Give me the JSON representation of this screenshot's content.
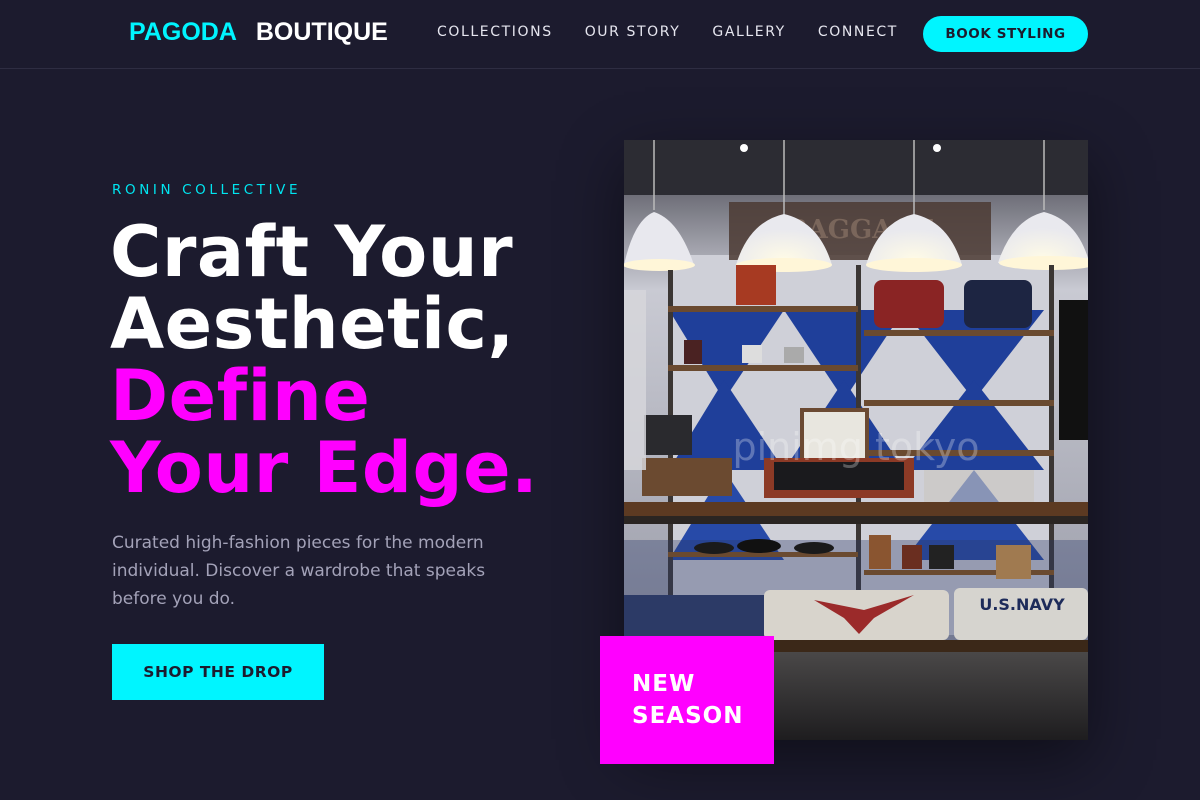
{
  "brand": {
    "part1": "PAGODA",
    "part2": "BOUTIQUE"
  },
  "nav": {
    "links": [
      "COLLECTIONS",
      "OUR STORY",
      "GALLERY",
      "CONNECT"
    ],
    "cta": "BOOK STYLING"
  },
  "hero": {
    "eyebrow": "RONIN COLLECTIVE",
    "headline": {
      "line1": "Craft Your",
      "line2": "Aesthetic,",
      "line3": "Define",
      "line4": "Your Edge."
    },
    "description": "Curated high-fashion pieces for the modern individual. Discover a wardrobe that speaks before you do.",
    "button": "SHOP THE DROP"
  },
  "image": {
    "store_sign": "BAGGAGE",
    "watermark": "pinimg tokyo",
    "shirt_text": "U.S.NAVY",
    "badge_line1": "NEW",
    "badge_line2": "SEASON"
  },
  "colors": {
    "background": "#1c1b2e",
    "accent_cyan": "#00f5ff",
    "accent_magenta": "#ff00ff"
  }
}
